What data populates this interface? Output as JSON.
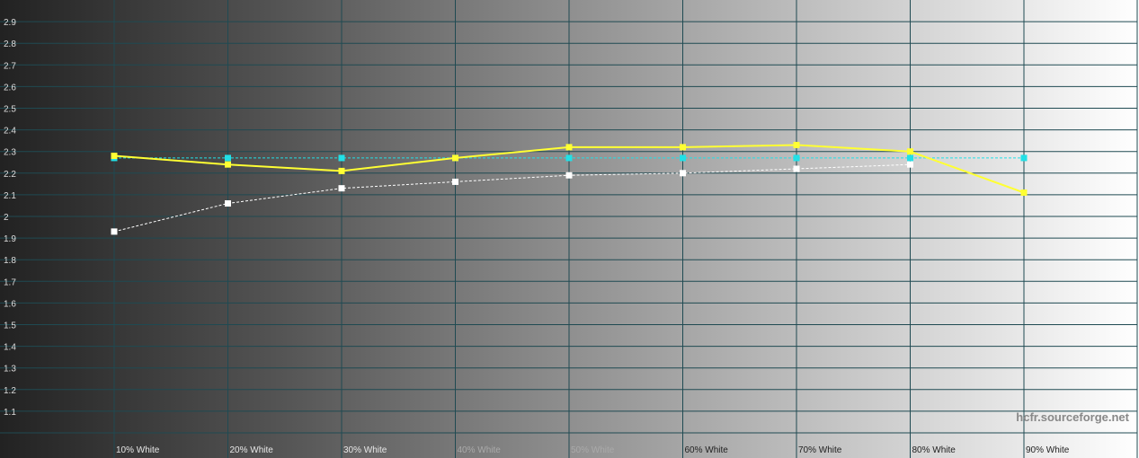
{
  "watermark": "hcfr.sourceforge.net",
  "colors": {
    "measured_gamma": "#ffff33",
    "target_gamma": "#22e0e6",
    "average_gamma": "#ffffff",
    "grid": "#1f4a52"
  },
  "chart_data": {
    "type": "line",
    "title": "",
    "xlabel": "",
    "ylabel": "",
    "ylim": [
      1.0,
      3.0
    ],
    "yticks": [
      1.1,
      1.2,
      1.3,
      1.4,
      1.5,
      1.6,
      1.7,
      1.8,
      1.9,
      2,
      2.1,
      2.2,
      2.3,
      2.4,
      2.5,
      2.6,
      2.7,
      2.8,
      2.9
    ],
    "categories": [
      "10% White",
      "20% White",
      "30% White",
      "40% White",
      "50% White",
      "60% White",
      "70% White",
      "80% White",
      "90% White"
    ],
    "grid": true,
    "background": "grayscale gradient dark to light",
    "series": [
      {
        "key": "measured",
        "style": "solid",
        "values": [
          2.28,
          2.24,
          2.21,
          2.27,
          2.32,
          2.32,
          2.33,
          2.3,
          2.11
        ]
      },
      {
        "key": "target",
        "style": "dashed",
        "values": [
          2.27,
          2.27,
          2.27,
          2.27,
          2.27,
          2.27,
          2.27,
          2.27,
          2.27
        ]
      },
      {
        "key": "average",
        "style": "dashed",
        "values": [
          1.93,
          2.06,
          2.13,
          2.16,
          2.19,
          2.2,
          2.22,
          2.24,
          null
        ]
      }
    ]
  }
}
